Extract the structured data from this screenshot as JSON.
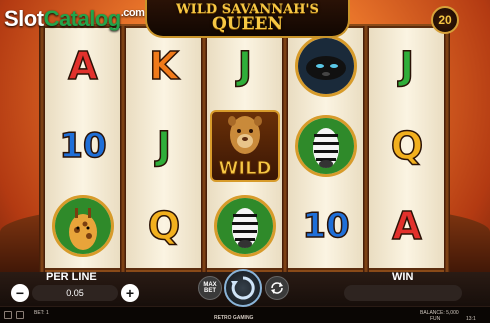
{
  "watermark": {
    "part1": "Slot",
    "part2": "Catalog",
    "part3": ".com"
  },
  "title": {
    "line1": "WILD SAVANNAH'S",
    "line2": "QUEEN"
  },
  "paylines": "20",
  "reels": [
    [
      {
        "type": "letter",
        "value": "A",
        "cls": "sym-a"
      },
      {
        "type": "letter",
        "value": "10",
        "cls": "sym-10"
      },
      {
        "type": "animal",
        "icon": "giraffe-icon"
      }
    ],
    [
      {
        "type": "letter",
        "value": "K",
        "cls": "sym-k"
      },
      {
        "type": "letter",
        "value": "J",
        "cls": "sym-j"
      },
      {
        "type": "letter",
        "value": "Q",
        "cls": "sym-q"
      }
    ],
    [
      {
        "type": "letter",
        "value": "J",
        "cls": "sym-j"
      },
      {
        "type": "wild",
        "icon": "lioness-icon",
        "label": "WILD"
      },
      {
        "type": "animal",
        "icon": "zebra-icon"
      }
    ],
    [
      {
        "type": "animal",
        "icon": "panther-icon"
      },
      {
        "type": "animal",
        "icon": "zebra-icon"
      },
      {
        "type": "letter",
        "value": "10",
        "cls": "sym-10"
      }
    ],
    [
      {
        "type": "letter",
        "value": "J",
        "cls": "sym-j"
      },
      {
        "type": "letter",
        "value": "Q",
        "cls": "sym-q"
      },
      {
        "type": "letter",
        "value": "A",
        "cls": "sym-a"
      }
    ]
  ],
  "controls": {
    "per_line_label": "PER LINE",
    "bet_value": "0.05",
    "minus": "−",
    "plus": "+",
    "max_bet_label": "MAX BET",
    "win_label": "WIN",
    "win_value": ""
  },
  "status": {
    "bet": "BET: 1",
    "provider": "RETRO GAMING",
    "balance": "BALANCE: 5,000",
    "mode": "FUN",
    "time": "13:1"
  }
}
